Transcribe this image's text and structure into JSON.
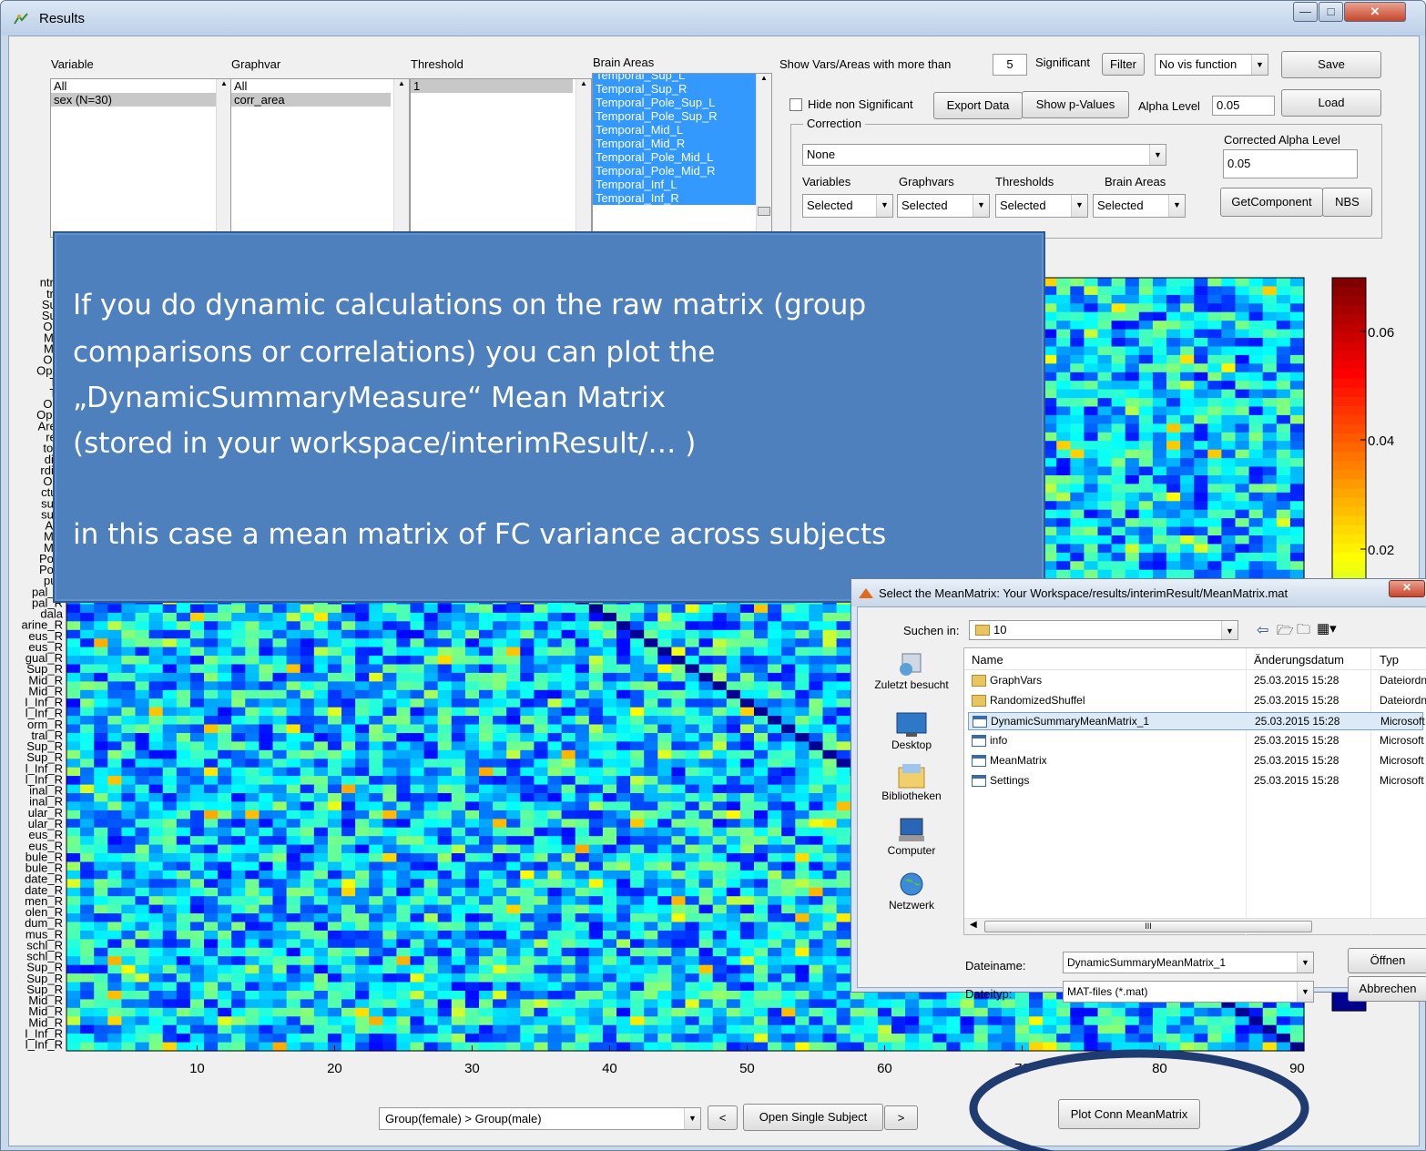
{
  "window": {
    "title": "Results",
    "icon": "matlab-figure-icon",
    "buttons": [
      "minimize-icon",
      "maximize-icon",
      "close-icon"
    ]
  },
  "lists": {
    "variable": {
      "label": "Variable",
      "items": [
        "All",
        "sex (N=30)"
      ],
      "selected": 1
    },
    "graphvar": {
      "label": "Graphvar",
      "items": [
        "All",
        "corr_area"
      ],
      "selected": 1
    },
    "threshold": {
      "label": "Threshold",
      "items": [
        "1"
      ],
      "selected": 0
    },
    "brain_areas": {
      "label": "Brain Areas",
      "items": [
        "Temporal_Sup_L",
        "Temporal_Sup_R",
        "Temporal_Pole_Sup_L",
        "Temporal_Pole_Sup_R",
        "Temporal_Mid_L",
        "Temporal_Mid_R",
        "Temporal_Pole_Mid_L",
        "Temporal_Pole_Mid_R",
        "Temporal_Inf_L",
        "Temporal_Inf_R"
      ]
    }
  },
  "controls": {
    "show_vars_label": "Show Vars/Areas with more than",
    "show_vars_value": "5",
    "significant_label": "Significant",
    "filter_button": "Filter",
    "vis_function": "No vis function",
    "save_button": "Save",
    "hide_non_significant": "Hide non Significant",
    "export_data": "Export Data",
    "show_pvalues": "Show p-Values",
    "alpha_level_label": "Alpha Level",
    "alpha_level_value": "0.05",
    "load_button": "Load",
    "correction_group": "Correction",
    "correction_value": "None",
    "corrected_alpha_label": "Corrected Alpha Level",
    "corrected_alpha_value": "0.05",
    "variables_label": "Variables",
    "graphvars_label": "Graphvars",
    "thresholds_label": "Thresholds",
    "brain_areas_label": "Brain Areas",
    "variables_value": "Selected",
    "graphvars_value": "Selected",
    "thresholds_value": "Selected",
    "brain_areas_value": "Selected",
    "get_component": "GetComponent",
    "nbs": "NBS"
  },
  "bottom": {
    "comparison": "Group(female) > Group(male)",
    "prev": "<",
    "open_single": "Open Single Subject",
    "next": ">",
    "plot_conn": "Plot Conn MeanMatrix"
  },
  "callout": {
    "lines": [
      "If you do dynamic calculations on the raw matrix (group",
      "comparisons or correlations) you can plot the",
      "„DynamicSummaryMeasure“ Mean Matrix",
      "(stored in your workspace/interimResult/…  )",
      "in this case a mean matrix of FC variance across subjects"
    ]
  },
  "chart_data": {
    "type": "heatmap",
    "x_ticks": [
      "10",
      "20",
      "30",
      "40",
      "50",
      "60",
      "70",
      "80",
      "90"
    ],
    "colorbar_ticks": [
      "0.06",
      "0.04",
      "0.02"
    ],
    "colormap": "jet",
    "y_tick_labels_visible": [
      "ntral",
      "tral",
      "Sup",
      "Sup",
      "Orb",
      "Mid",
      "Mid",
      "Orb",
      "Oper",
      "Tri",
      "Tri",
      "Orb",
      "Oper",
      "Area",
      "rea",
      "tory",
      "dial",
      "rdial",
      "Orb",
      "ctus",
      "sula",
      "sula",
      "Ant",
      "Mid",
      "Mid",
      "Post",
      "Post",
      "pus",
      "pal_R",
      "pal_R",
      "dala",
      "arine_R",
      "eus_R",
      "eus_R",
      "gual_R",
      "Sup_R",
      "Mid_R",
      "Mid_R",
      "I_Inf_R",
      "l_Inf_R",
      "orm_R",
      "tral_R",
      "Sup_R",
      "Sup_R",
      "l_Inf_R",
      "l_Inf_R",
      "inal_R",
      "inal_R",
      "ular_R",
      "ular_R",
      "eus_R",
      "eus_R",
      "bule_R",
      "bule_R",
      "date_R",
      "date_R",
      "men_R",
      "olen_R",
      "dum_R",
      "mus_R",
      "schl_R",
      "schl_R",
      "Sup_R",
      "Sup_R",
      "Sup_R",
      "Mid_R",
      "Mid_R",
      "Mid_R",
      "I_Inf_R",
      "l_Inf_R"
    ]
  },
  "dialog": {
    "title": "Select the MeanMatrix: Your Workspace/results/interimResult/MeanMatrix.mat",
    "look_in_label": "Suchen in:",
    "look_in_value": "10",
    "places": [
      "Zuletzt besucht",
      "Desktop",
      "Bibliotheken",
      "Computer",
      "Netzwerk"
    ],
    "columns": [
      "Name",
      "Änderungsdatum",
      "Typ"
    ],
    "files": [
      {
        "name": "GraphVars",
        "date": "25.03.2015 15:28",
        "type": "Dateiordn",
        "kind": "folder"
      },
      {
        "name": "RandomizedShuffel",
        "date": "25.03.2015 15:28",
        "type": "Dateiordn",
        "kind": "folder"
      },
      {
        "name": "DynamicSummaryMeanMatrix_1",
        "date": "25.03.2015 15:28",
        "type": "Microsoft",
        "kind": "mat"
      },
      {
        "name": "info",
        "date": "25.03.2015 15:28",
        "type": "Microsoft",
        "kind": "mat"
      },
      {
        "name": "MeanMatrix",
        "date": "25.03.2015 15:28",
        "type": "Microsoft",
        "kind": "mat"
      },
      {
        "name": "Settings",
        "date": "25.03.2015 15:28",
        "type": "Microsoft",
        "kind": "mat"
      }
    ],
    "filename_label": "Dateiname:",
    "filename_value": "DynamicSummaryMeanMatrix_1",
    "filetype_label": "Dateityp:",
    "filetype_value": "MAT-files (*.mat)",
    "open_button": "Öffnen",
    "cancel_button": "Abbrechen",
    "scroll_mark": "III",
    "colors": {
      "accent": "#3399ff",
      "title_bg": "#c8d7ea"
    }
  }
}
